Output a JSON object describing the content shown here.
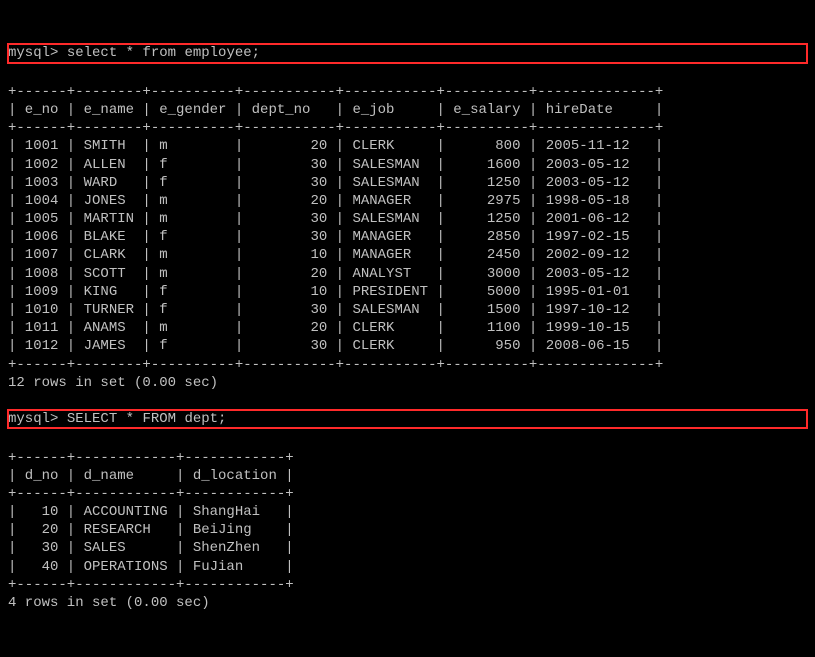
{
  "q1": {
    "prompt": "mysql>",
    "sql": "select * from employee;",
    "cols": [
      "e_no",
      "e_name",
      "e_gender",
      "dept_no",
      "e_job",
      "e_salary",
      "hireDate"
    ],
    "rows": [
      [
        "1001",
        "SMITH",
        "m",
        "20",
        "CLERK",
        "800",
        "2005-11-12"
      ],
      [
        "1002",
        "ALLEN",
        "f",
        "30",
        "SALESMAN",
        "1600",
        "2003-05-12"
      ],
      [
        "1003",
        "WARD",
        "f",
        "30",
        "SALESMAN",
        "1250",
        "2003-05-12"
      ],
      [
        "1004",
        "JONES",
        "m",
        "20",
        "MANAGER",
        "2975",
        "1998-05-18"
      ],
      [
        "1005",
        "MARTIN",
        "m",
        "30",
        "SALESMAN",
        "1250",
        "2001-06-12"
      ],
      [
        "1006",
        "BLAKE",
        "f",
        "30",
        "MANAGER",
        "2850",
        "1997-02-15"
      ],
      [
        "1007",
        "CLARK",
        "m",
        "10",
        "MANAGER",
        "2450",
        "2002-09-12"
      ],
      [
        "1008",
        "SCOTT",
        "m",
        "20",
        "ANALYST",
        "3000",
        "2003-05-12"
      ],
      [
        "1009",
        "KING",
        "f",
        "10",
        "PRESIDENT",
        "5000",
        "1995-01-01"
      ],
      [
        "1010",
        "TURNER",
        "f",
        "30",
        "SALESMAN",
        "1500",
        "1997-10-12"
      ],
      [
        "1011",
        "ANAMS",
        "m",
        "20",
        "CLERK",
        "1100",
        "1999-10-15"
      ],
      [
        "1012",
        "JAMES",
        "f",
        "30",
        "CLERK",
        "950",
        "2008-06-15"
      ]
    ],
    "footer": "12 rows in set (0.00 sec)"
  },
  "q2": {
    "prompt": "mysql>",
    "sql": "SELECT * FROM dept;",
    "cols": [
      "d_no",
      "d_name",
      "d_location"
    ],
    "rows": [
      [
        "10",
        "ACCOUNTING",
        "ShangHai"
      ],
      [
        "20",
        "RESEARCH",
        "BeiJing"
      ],
      [
        "30",
        "SALES",
        "ShenZhen"
      ],
      [
        "40",
        "OPERATIONS",
        "FuJian"
      ]
    ],
    "footer": "4 rows in set (0.00 sec)"
  },
  "chart_data": [
    {
      "type": "table",
      "title": "employee",
      "columns": [
        "e_no",
        "e_name",
        "e_gender",
        "dept_no",
        "e_job",
        "e_salary",
        "hireDate"
      ],
      "rows": [
        [
          1001,
          "SMITH",
          "m",
          20,
          "CLERK",
          800,
          "2005-11-12"
        ],
        [
          1002,
          "ALLEN",
          "f",
          30,
          "SALESMAN",
          1600,
          "2003-05-12"
        ],
        [
          1003,
          "WARD",
          "f",
          30,
          "SALESMAN",
          1250,
          "2003-05-12"
        ],
        [
          1004,
          "JONES",
          "m",
          20,
          "MANAGER",
          2975,
          "1998-05-18"
        ],
        [
          1005,
          "MARTIN",
          "m",
          30,
          "SALESMAN",
          1250,
          "2001-06-12"
        ],
        [
          1006,
          "BLAKE",
          "f",
          30,
          "MANAGER",
          2850,
          "1997-02-15"
        ],
        [
          1007,
          "CLARK",
          "m",
          10,
          "MANAGER",
          2450,
          "2002-09-12"
        ],
        [
          1008,
          "SCOTT",
          "m",
          20,
          "ANALYST",
          3000,
          "2003-05-12"
        ],
        [
          1009,
          "KING",
          "f",
          10,
          "PRESIDENT",
          5000,
          "1995-01-01"
        ],
        [
          1010,
          "TURNER",
          "f",
          30,
          "SALESMAN",
          1500,
          "1997-10-12"
        ],
        [
          1011,
          "ANAMS",
          "m",
          20,
          "CLERK",
          1100,
          "1999-10-15"
        ],
        [
          1012,
          "JAMES",
          "f",
          30,
          "CLERK",
          950,
          "2008-06-15"
        ]
      ]
    },
    {
      "type": "table",
      "title": "dept",
      "columns": [
        "d_no",
        "d_name",
        "d_location"
      ],
      "rows": [
        [
          10,
          "ACCOUNTING",
          "ShangHai"
        ],
        [
          20,
          "RESEARCH",
          "BeiJing"
        ],
        [
          30,
          "SALES",
          "ShenZhen"
        ],
        [
          40,
          "OPERATIONS",
          "FuJian"
        ]
      ]
    }
  ]
}
